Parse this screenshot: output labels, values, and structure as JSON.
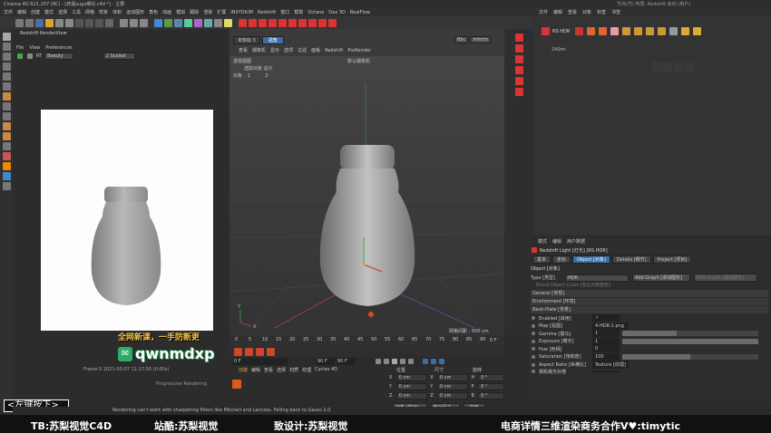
{
  "window": {
    "title": "Cinema 4D R21.207 (RC) - [药瓶sugo细化.c4d *] - 主要",
    "right_status": "节点(节) 布局: Redshift 启动 (用户)"
  },
  "menubar": {
    "items": [
      "文件",
      "编辑",
      "创建",
      "模式",
      "选择",
      "工具",
      "网格",
      "样条",
      "体积",
      "运动图形",
      "角色",
      "动画",
      "模拟",
      "跟踪",
      "渲染",
      "扩展",
      "INSYDIUM",
      "Redshift",
      "窗口",
      "帮助",
      "Octane",
      "Dax 3D",
      "RealFlow"
    ],
    "right_items": [
      "文件",
      "编辑",
      "查看",
      "对象",
      "标签",
      "书签"
    ]
  },
  "render_view": {
    "title": "Redshift RenderView",
    "menu": [
      "File",
      "View",
      "Preferences"
    ],
    "toolbar": [
      "RT",
      "Beauty",
      "2 Scaled"
    ],
    "status_text": "Progressive Rendering",
    "footer_text": "Frame 0    2021-03-07  11:17:56  (0.00s)",
    "warning_text": "Rendering can't work with sharpening filters like Mitchell and Lanczos. Falling back to Gauss 2.0"
  },
  "viewport": {
    "tabs": [
      "未知标 3",
      "视角"
    ],
    "menu": [
      "查看",
      "摄像机",
      "显示",
      "选项",
      "过滤",
      "面板",
      "Redshift",
      "ProRender"
    ],
    "mini_buttons": [
      "Bbc",
      "mforth"
    ],
    "label": "透视视图",
    "camera": "默认摄像机",
    "stats": {
      "header": "选取对象  总计",
      "row_label": "对象",
      "selected": "1",
      "total": "2"
    },
    "grid_spacing": "网格间距 : 500 cm"
  },
  "timeline": {
    "ticks": [
      "0",
      "5",
      "10",
      "15",
      "20",
      "25",
      "30",
      "35",
      "40",
      "45",
      "50",
      "55",
      "60",
      "65",
      "70",
      "75",
      "80",
      "85",
      "90"
    ],
    "current_frame": "0 F",
    "start_field": "0 F",
    "end_field": "90 F",
    "end_field2": "90 F",
    "frame_readout": "0 F"
  },
  "material_bar": {
    "tabs": [
      "创建",
      "编辑",
      "查看",
      "选择",
      "材质",
      "纹理",
      "Cycles 4D"
    ]
  },
  "coordinates": {
    "headers": [
      "位置",
      "尺寸",
      "旋转"
    ],
    "rows": [
      {
        "axis": "X",
        "pos": "0 cm",
        "size": "0 cm",
        "rot_axis": "H",
        "rot": "0 °"
      },
      {
        "axis": "Y",
        "pos": "0 cm",
        "size": "0 cm",
        "rot_axis": "P",
        "rot": "0 °"
      },
      {
        "axis": "Z",
        "pos": "0 cm",
        "size": "0 cm",
        "rot_axis": "B",
        "rot": "0 °"
      }
    ],
    "mode1": "对象 (相对)",
    "mode2": "绝对尺寸",
    "apply": "应用"
  },
  "object_manager": {
    "object_name": "RS HDR",
    "sub_text": "240mi"
  },
  "attributes": {
    "tabs": [
      "模式",
      "编辑",
      "用户数据"
    ],
    "title": "Redshift Light [灯光] [RS HDR]",
    "tab_row": [
      "基本",
      "坐标",
      "Object [对象]",
      "Details [细节]",
      "Project [项目]"
    ],
    "section": "Object [对象]",
    "type_label": "Type [类型]",
    "type_value": "HDR",
    "add_graph": "Add Graph [添加图形]",
    "edit_graph": "Edit Graph [编辑图形]",
    "blend_label": "Blend Object Color [混合对象颜色]",
    "groups": [
      "General [常规]",
      "Environment [环境]",
      "Back-Plate [背景]"
    ],
    "fields": [
      {
        "label": "Enabled [启用]",
        "value": "✓",
        "fill": 0
      },
      {
        "label": "Map [贴图]",
        "value": "4-HDR-1.png",
        "fill": 0
      },
      {
        "label": "Gamma [伽马]",
        "value": "1",
        "fill": 0.4
      },
      {
        "label": "Exposure [曝光]",
        "value": "1",
        "fill": 1.0
      },
      {
        "label": "Hue [色相]",
        "value": "0",
        "fill": 0
      },
      {
        "label": "Saturation [饱和度]",
        "value": "100",
        "fill": 0.5
      },
      {
        "label": "Aspect Ratio [纵横比]",
        "value": "Texture [纹理]",
        "fill": 0
      },
      {
        "label": "相机曝光补偿",
        "value": "",
        "fill": 0
      }
    ]
  },
  "overlays": {
    "promo_line": "全网新课，一手防断更",
    "wechat_id": "qwnmdxp",
    "left_key_hint": "<左键按下>",
    "watermark": "苏梨视觉"
  },
  "bottom_banner": {
    "items": [
      "TB:苏梨视觉C4D",
      "站酷:苏梨视觉",
      "致设计:苏梨视觉",
      "电商详情三维渲染商务合作V♥:timytic"
    ]
  },
  "colors": {
    "accent": "#e6a23c",
    "wechat_green": "#2aae67",
    "selection": "#3a6ea5",
    "brand_orange": "#e05a1a"
  }
}
